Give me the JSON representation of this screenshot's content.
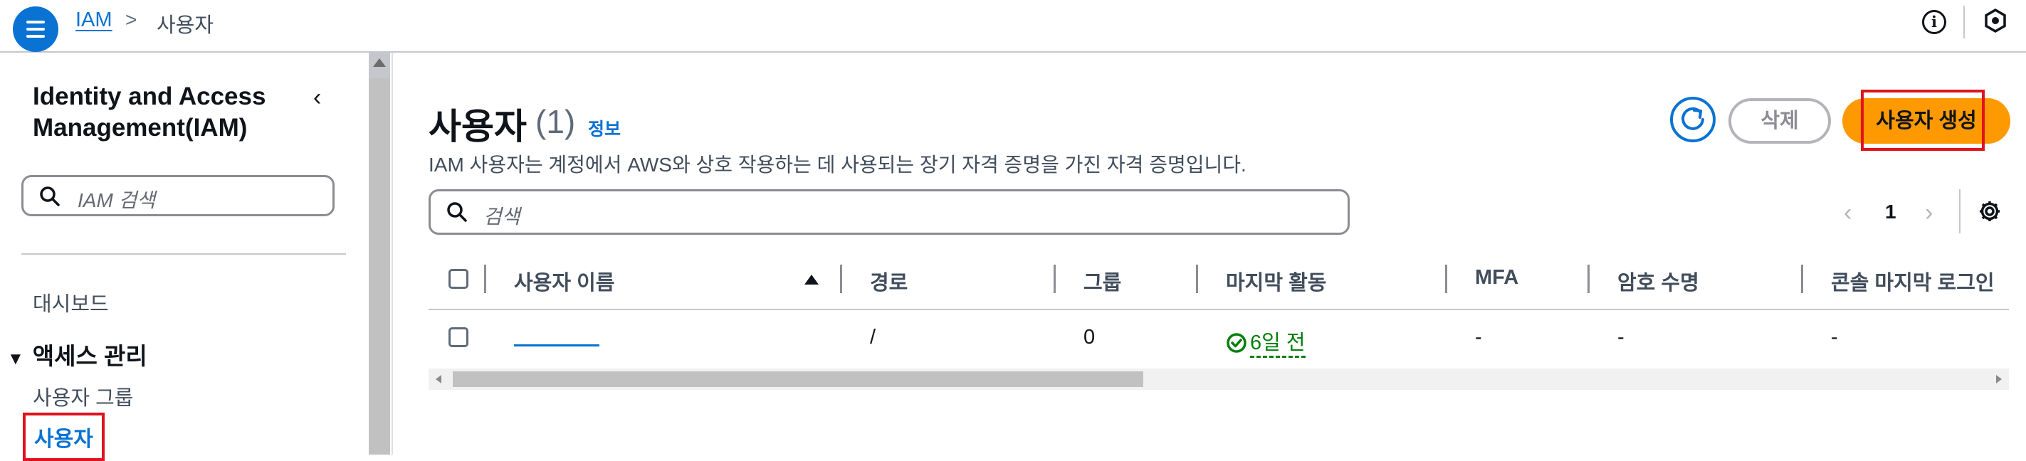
{
  "topbar": {
    "breadcrumb_root": "IAM",
    "breadcrumb_separator": ">",
    "breadcrumb_current": "사용자",
    "info_glyph": "i",
    "icons": [
      "hamburger-menu-icon",
      "info-icon",
      "hexagon-icon"
    ]
  },
  "sidenav": {
    "title": "Identity and Access Management(IAM)",
    "collapse_glyph": "‹",
    "search_placeholder": "IAM 검색",
    "dashboard": "대시보드",
    "section_label": "액세스 관리",
    "section_toggle": "▼",
    "items": [
      {
        "label": "사용자 그룹",
        "active": false
      },
      {
        "label": "사용자",
        "active": true
      }
    ]
  },
  "main": {
    "title": "사용자",
    "count": "(1)",
    "info_link": "정보",
    "description": "IAM 사용자는 계정에서 AWS와 상호 작용하는 데 사용되는 장기 자격 증명을 가진 자격 증명입니다.",
    "buttons": {
      "refresh_icon": "refresh-icon",
      "delete": "삭제",
      "create": "사용자 생성"
    },
    "search_placeholder": "검색",
    "pagination": {
      "prev": "‹",
      "page": "1",
      "next": "›",
      "settings_icon": "gear-icon"
    },
    "table": {
      "columns": [
        "사용자 이름",
        "경로",
        "그룹",
        "마지막 활동",
        "MFA",
        "암호 수명",
        "콘솔 마지막 로그인"
      ],
      "rows": [
        {
          "username": "",
          "path": "/",
          "groups": "0",
          "last_activity": "6일 전",
          "mfa": "-",
          "password_age": "-",
          "console_last_login": "-"
        }
      ]
    }
  },
  "colors": {
    "primary": "#0972d3",
    "create_button": "#ff9900",
    "success": "#037f0c",
    "highlight_box": "#e0121d"
  }
}
